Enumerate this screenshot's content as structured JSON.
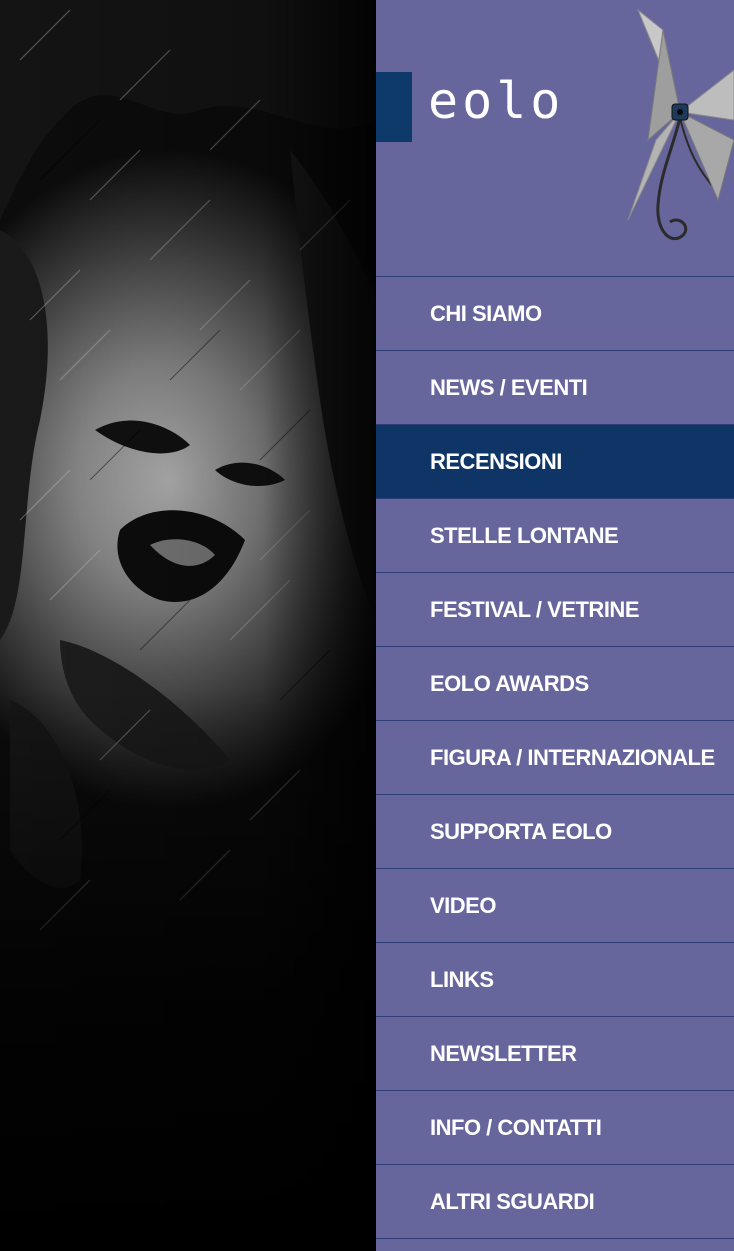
{
  "brand": {
    "logo_text": "eolo",
    "accent_color": "#0e3a6b",
    "sidebar_color": "#67669c"
  },
  "nav": {
    "items": [
      {
        "label": "CHI SIAMO",
        "active": false
      },
      {
        "label": "NEWS / EVENTI",
        "active": false
      },
      {
        "label": "RECENSIONI",
        "active": true
      },
      {
        "label": "STELLE LONTANE",
        "active": false
      },
      {
        "label": "FESTIVAL / VETRINE",
        "active": false
      },
      {
        "label": "EOLO AWARDS",
        "active": false
      },
      {
        "label": "FIGURA / INTERNAZIONALE",
        "active": false
      },
      {
        "label": "SUPPORTA EOLO",
        "active": false
      },
      {
        "label": "VIDEO",
        "active": false
      },
      {
        "label": "LINKS",
        "active": false
      },
      {
        "label": "NEWSLETTER",
        "active": false
      },
      {
        "label": "INFO / CONTATTI",
        "active": false
      },
      {
        "label": "ALTRI SGUARDI",
        "active": false
      }
    ]
  },
  "icons": {
    "logo": "windmill-icon",
    "hero": "portrait-photo"
  }
}
